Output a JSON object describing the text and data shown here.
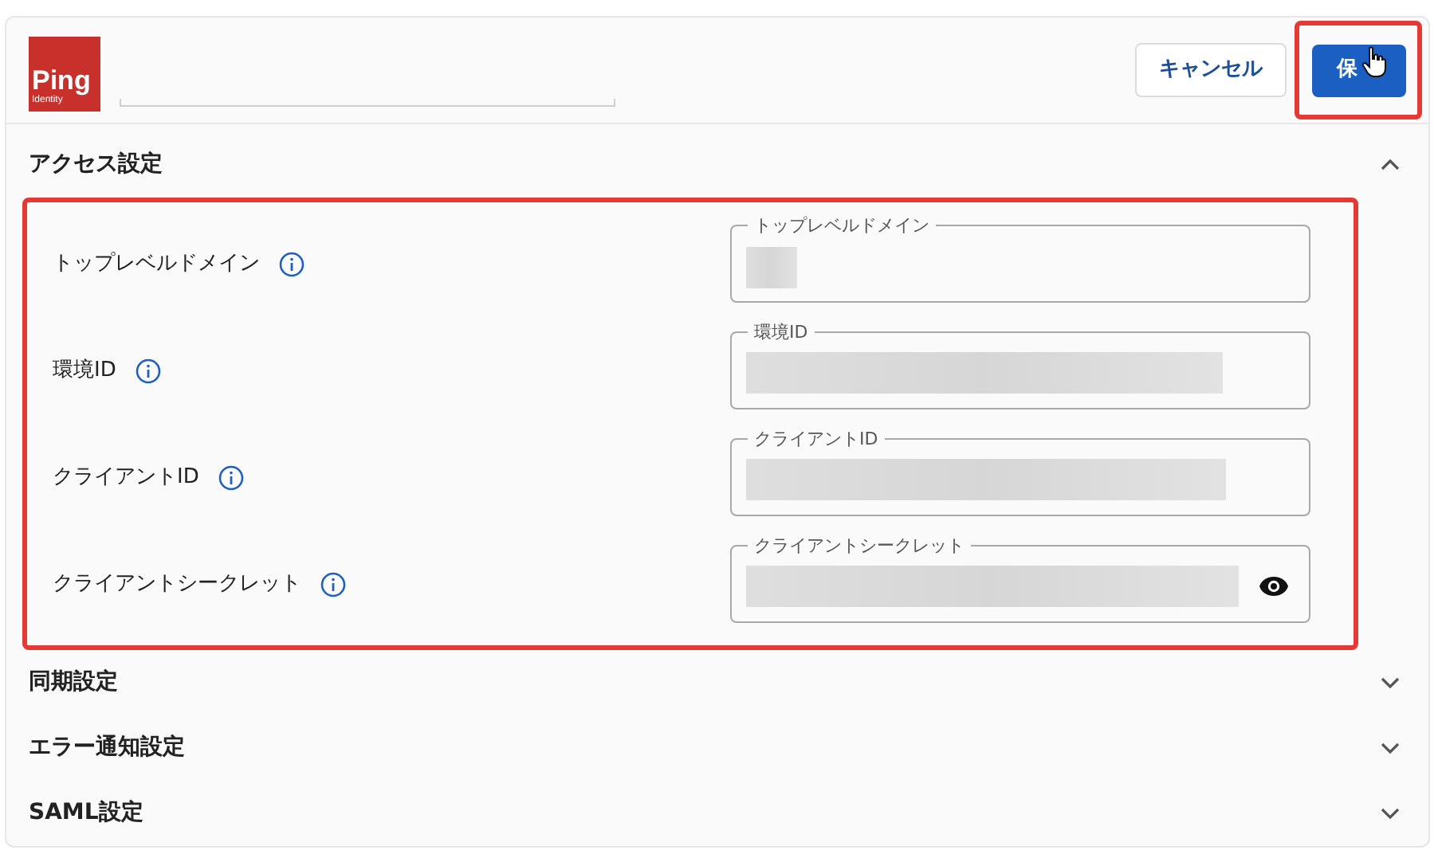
{
  "header": {
    "logo": {
      "word": "Ping",
      "sub": "Identity"
    },
    "cancel_button": "キャンセル",
    "save_button": {
      "label": "保",
      "highlighted": true
    }
  },
  "sections": [
    {
      "title": "アクセス設定",
      "expanded": true,
      "highlighted": true,
      "fields": [
        {
          "label": "トップレベルドメイン",
          "field_label": "トップレベルドメイン",
          "kind": "text"
        },
        {
          "label": "環境ID",
          "field_label": "環境ID",
          "kind": "text"
        },
        {
          "label": "クライアントID",
          "field_label": "クライアントID",
          "kind": "text"
        },
        {
          "label": "クライアントシークレット",
          "field_label": "クライアントシークレット",
          "kind": "secret"
        }
      ]
    },
    {
      "title": "同期設定",
      "expanded": false
    },
    {
      "title": "エラー通知設定",
      "expanded": false
    },
    {
      "title": "SAML設定",
      "expanded": false
    }
  ]
}
